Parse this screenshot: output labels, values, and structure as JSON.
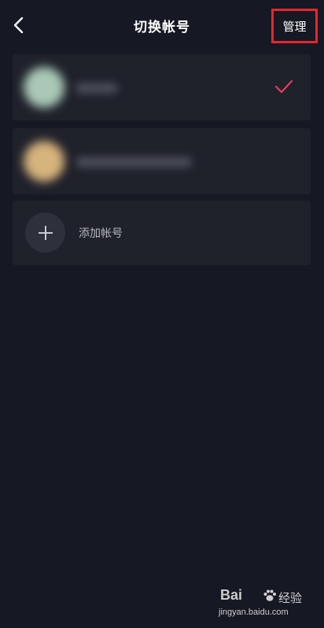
{
  "header": {
    "title": "切换帐号",
    "manage_label": "管理",
    "back_icon": "chevron-left-icon"
  },
  "accounts": [
    {
      "selected": true,
      "status_icon": "check-icon",
      "status_color": "#ea3a61",
      "avatar_color": "#a9c9b6"
    },
    {
      "selected": false,
      "avatar_color": "#d7b47d"
    }
  ],
  "add_account": {
    "label": "添加帐号",
    "icon": "plus-icon"
  },
  "watermark": {
    "brand": "Bai",
    "jingyan": "经验",
    "url": "jingyan.baidu.com"
  },
  "colors": {
    "background": "#161823",
    "card": "#1f212b",
    "highlight_border": "#e8262d",
    "accent": "#ea3a61"
  }
}
